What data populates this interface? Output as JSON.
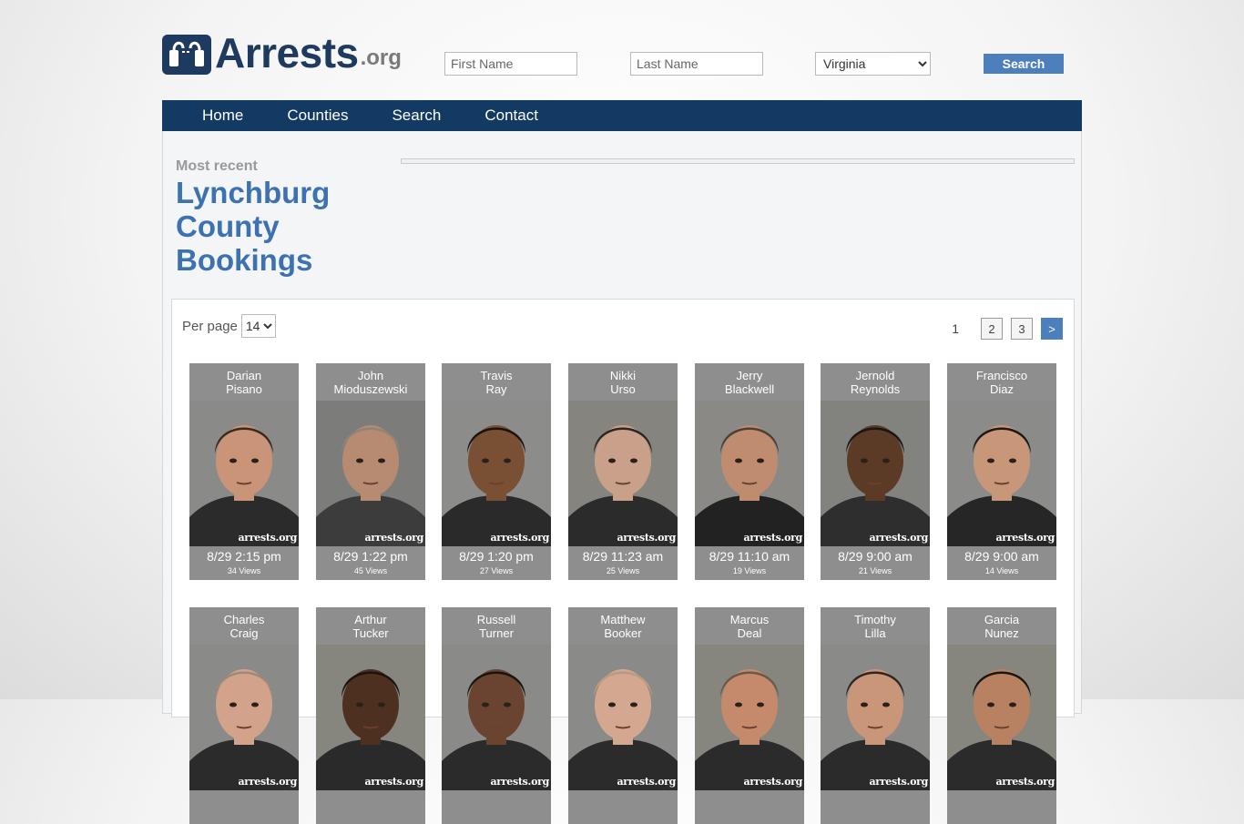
{
  "logo": {
    "text": "Arrests",
    "ext": ".org"
  },
  "search": {
    "first_placeholder": "First Name",
    "last_placeholder": "Last Name",
    "state_selected": "Virginia",
    "button_label": "Search"
  },
  "nav": [
    "Home",
    "Counties",
    "Search",
    "Contact"
  ],
  "heading": {
    "kicker": "Most recent",
    "title": "Lynchburg County Bookings"
  },
  "listing": {
    "per_page_label": "Per page",
    "per_page_value": "14",
    "pages": [
      "1",
      "2",
      "3"
    ],
    "next_label": ">",
    "watermark": "arrests.org"
  },
  "colors": {
    "brand": "#1e3a5f",
    "nav": "#123a63",
    "accent": "#4d7fbd",
    "title": "#3d72b2",
    "card": "#8f8e8f"
  },
  "bookings": [
    {
      "first": "Darian",
      "last": "Pisano",
      "time": "8/29 2:15 pm",
      "views": "34 Views",
      "skin": "#c99478",
      "hair": "#3a2a1e",
      "shirt": "#2b2b2b",
      "bg": "#8a8a88"
    },
    {
      "first": "John",
      "last": "Mioduszewski",
      "time": "8/29 1:22 pm",
      "views": "45 Views",
      "skin": "#b78a72",
      "hair": "#8e8478",
      "shirt": "#3c3c3c",
      "bg": "#7c7c7a"
    },
    {
      "first": "Travis",
      "last": "Ray",
      "time": "8/29 1:20 pm",
      "views": "27 Views",
      "skin": "#7a5034",
      "hair": "#1a1410",
      "shirt": "#2a2a2a",
      "bg": "#8c8c8a"
    },
    {
      "first": "Nikki",
      "last": "Urso",
      "time": "8/29 11:23 am",
      "views": "25 Views",
      "skin": "#c9a089",
      "hair": "#2e2620",
      "shirt": "#2b2b2b",
      "bg": "#85847f"
    },
    {
      "first": "Jerry",
      "last": "Blackwell",
      "time": "8/29 11:10 am",
      "views": "19 Views",
      "skin": "#c08c70",
      "hair": "#4a4038",
      "shirt": "#222222",
      "bg": "#8a8986"
    },
    {
      "first": "Jernold",
      "last": "Reynolds",
      "time": "8/29 9:00 am",
      "views": "21 Views",
      "skin": "#5b3a26",
      "hair": "#1c1612",
      "shirt": "#2e2e2e",
      "bg": "#82827f"
    },
    {
      "first": "Francisco",
      "last": "Diaz",
      "time": "8/29 9:00 am",
      "views": "14 Views",
      "skin": "#c8977a",
      "hair": "#1e1814",
      "shirt": "#262626",
      "bg": "#8b8b89"
    },
    {
      "first": "Charles",
      "last": "Craig",
      "time": "",
      "views": "",
      "skin": "#d2a38a",
      "hair": "#9a8a78",
      "shirt": "#2b2b2b",
      "bg": "#8a8a88"
    },
    {
      "first": "Arthur",
      "last": "Tucker",
      "time": "",
      "views": "",
      "skin": "#4e3020",
      "hair": "#1a1410",
      "shirt": "#2a2a2a",
      "bg": "#86867f"
    },
    {
      "first": "Russell",
      "last": "Turner",
      "time": "",
      "views": "",
      "skin": "#6a4430",
      "hair": "#1a1410",
      "shirt": "#2b2b2b",
      "bg": "#8a8a88"
    },
    {
      "first": "Matthew",
      "last": "Booker",
      "time": "",
      "views": "",
      "skin": "#d4a890",
      "hair": "#b89a80",
      "shirt": "#2b2b2b",
      "bg": "#8a8a88"
    },
    {
      "first": "Marcus",
      "last": "Deal",
      "time": "",
      "views": "",
      "skin": "#c58a6c",
      "hair": "#6a5848",
      "shirt": "#2b2b2b",
      "bg": "#86867f"
    },
    {
      "first": "Timothy",
      "last": "Lilla",
      "time": "",
      "views": "",
      "skin": "#c9967a",
      "hair": "#2e2620",
      "shirt": "#2b2b2b",
      "bg": "#8a8a88"
    },
    {
      "first": "Garcia",
      "last": "Nunez",
      "time": "",
      "views": "",
      "skin": "#b88262",
      "hair": "#1c1612",
      "shirt": "#2b2b2b",
      "bg": "#86867f"
    }
  ]
}
